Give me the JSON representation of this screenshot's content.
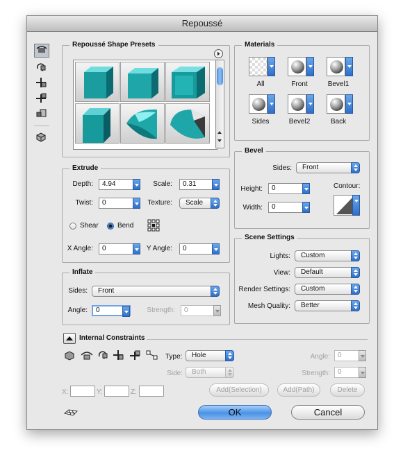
{
  "window": {
    "title": "Repoussé"
  },
  "toolbar": {
    "icons": [
      "object-rotate-icon",
      "object-roll-icon",
      "object-pan-icon",
      "object-slide-icon",
      "object-scale-icon",
      "camera-icon"
    ]
  },
  "presets": {
    "title": "Repoussé Shape Presets",
    "menu_icon": "right-arrow-icon"
  },
  "materials": {
    "title": "Materials",
    "items": [
      "All",
      "Front",
      "Bevel1",
      "Sides",
      "Bevel2",
      "Back"
    ]
  },
  "extrude": {
    "title": "Extrude",
    "depth_label": "Depth:",
    "depth_value": "4.94",
    "scale_label": "Scale:",
    "scale_value": "0.31",
    "twist_label": "Twist:",
    "twist_value": "0",
    "texture_label": "Texture:",
    "texture_value": "Scale",
    "shear_label": "Shear",
    "bend_label": "Bend",
    "xangle_label": "X Angle:",
    "xangle_value": "0",
    "yangle_label": "Y Angle:",
    "yangle_value": "0",
    "selected": "Bend"
  },
  "bevel": {
    "title": "Bevel",
    "sides_label": "Sides:",
    "sides_value": "Front",
    "height_label": "Height:",
    "height_value": "0",
    "width_label": "Width:",
    "width_value": "0",
    "contour_label": "Contour:"
  },
  "inflate": {
    "title": "Inflate",
    "sides_label": "Sides:",
    "sides_value": "Front",
    "angle_label": "Angle:",
    "angle_value": "0",
    "strength_label": "Strength:",
    "strength_value": "0"
  },
  "scene": {
    "title": "Scene Settings",
    "lights_label": "Lights:",
    "lights_value": "Custom",
    "view_label": "View:",
    "view_value": "Default",
    "render_label": "Render Settings:",
    "render_value": "Custom",
    "mesh_label": "Mesh Quality:",
    "mesh_value": "Better"
  },
  "constraints": {
    "title": "Internal Constraints",
    "type_label": "Type:",
    "type_value": "Hole",
    "side_label": "Side:",
    "side_value": "Both",
    "angle_label": "Angle:",
    "angle_value": "0",
    "strength_label": "Strength:",
    "strength_value": "0",
    "x_label": "X:",
    "y_label": "Y:",
    "z_label": "Z:",
    "add_selection": "Add(Selection)",
    "add_path": "Add(Path)",
    "delete": "Delete"
  },
  "buttons": {
    "ok": "OK",
    "cancel": "Cancel"
  },
  "colors": {
    "accent": "#4b92e6",
    "shape": "#1fa6a8"
  }
}
